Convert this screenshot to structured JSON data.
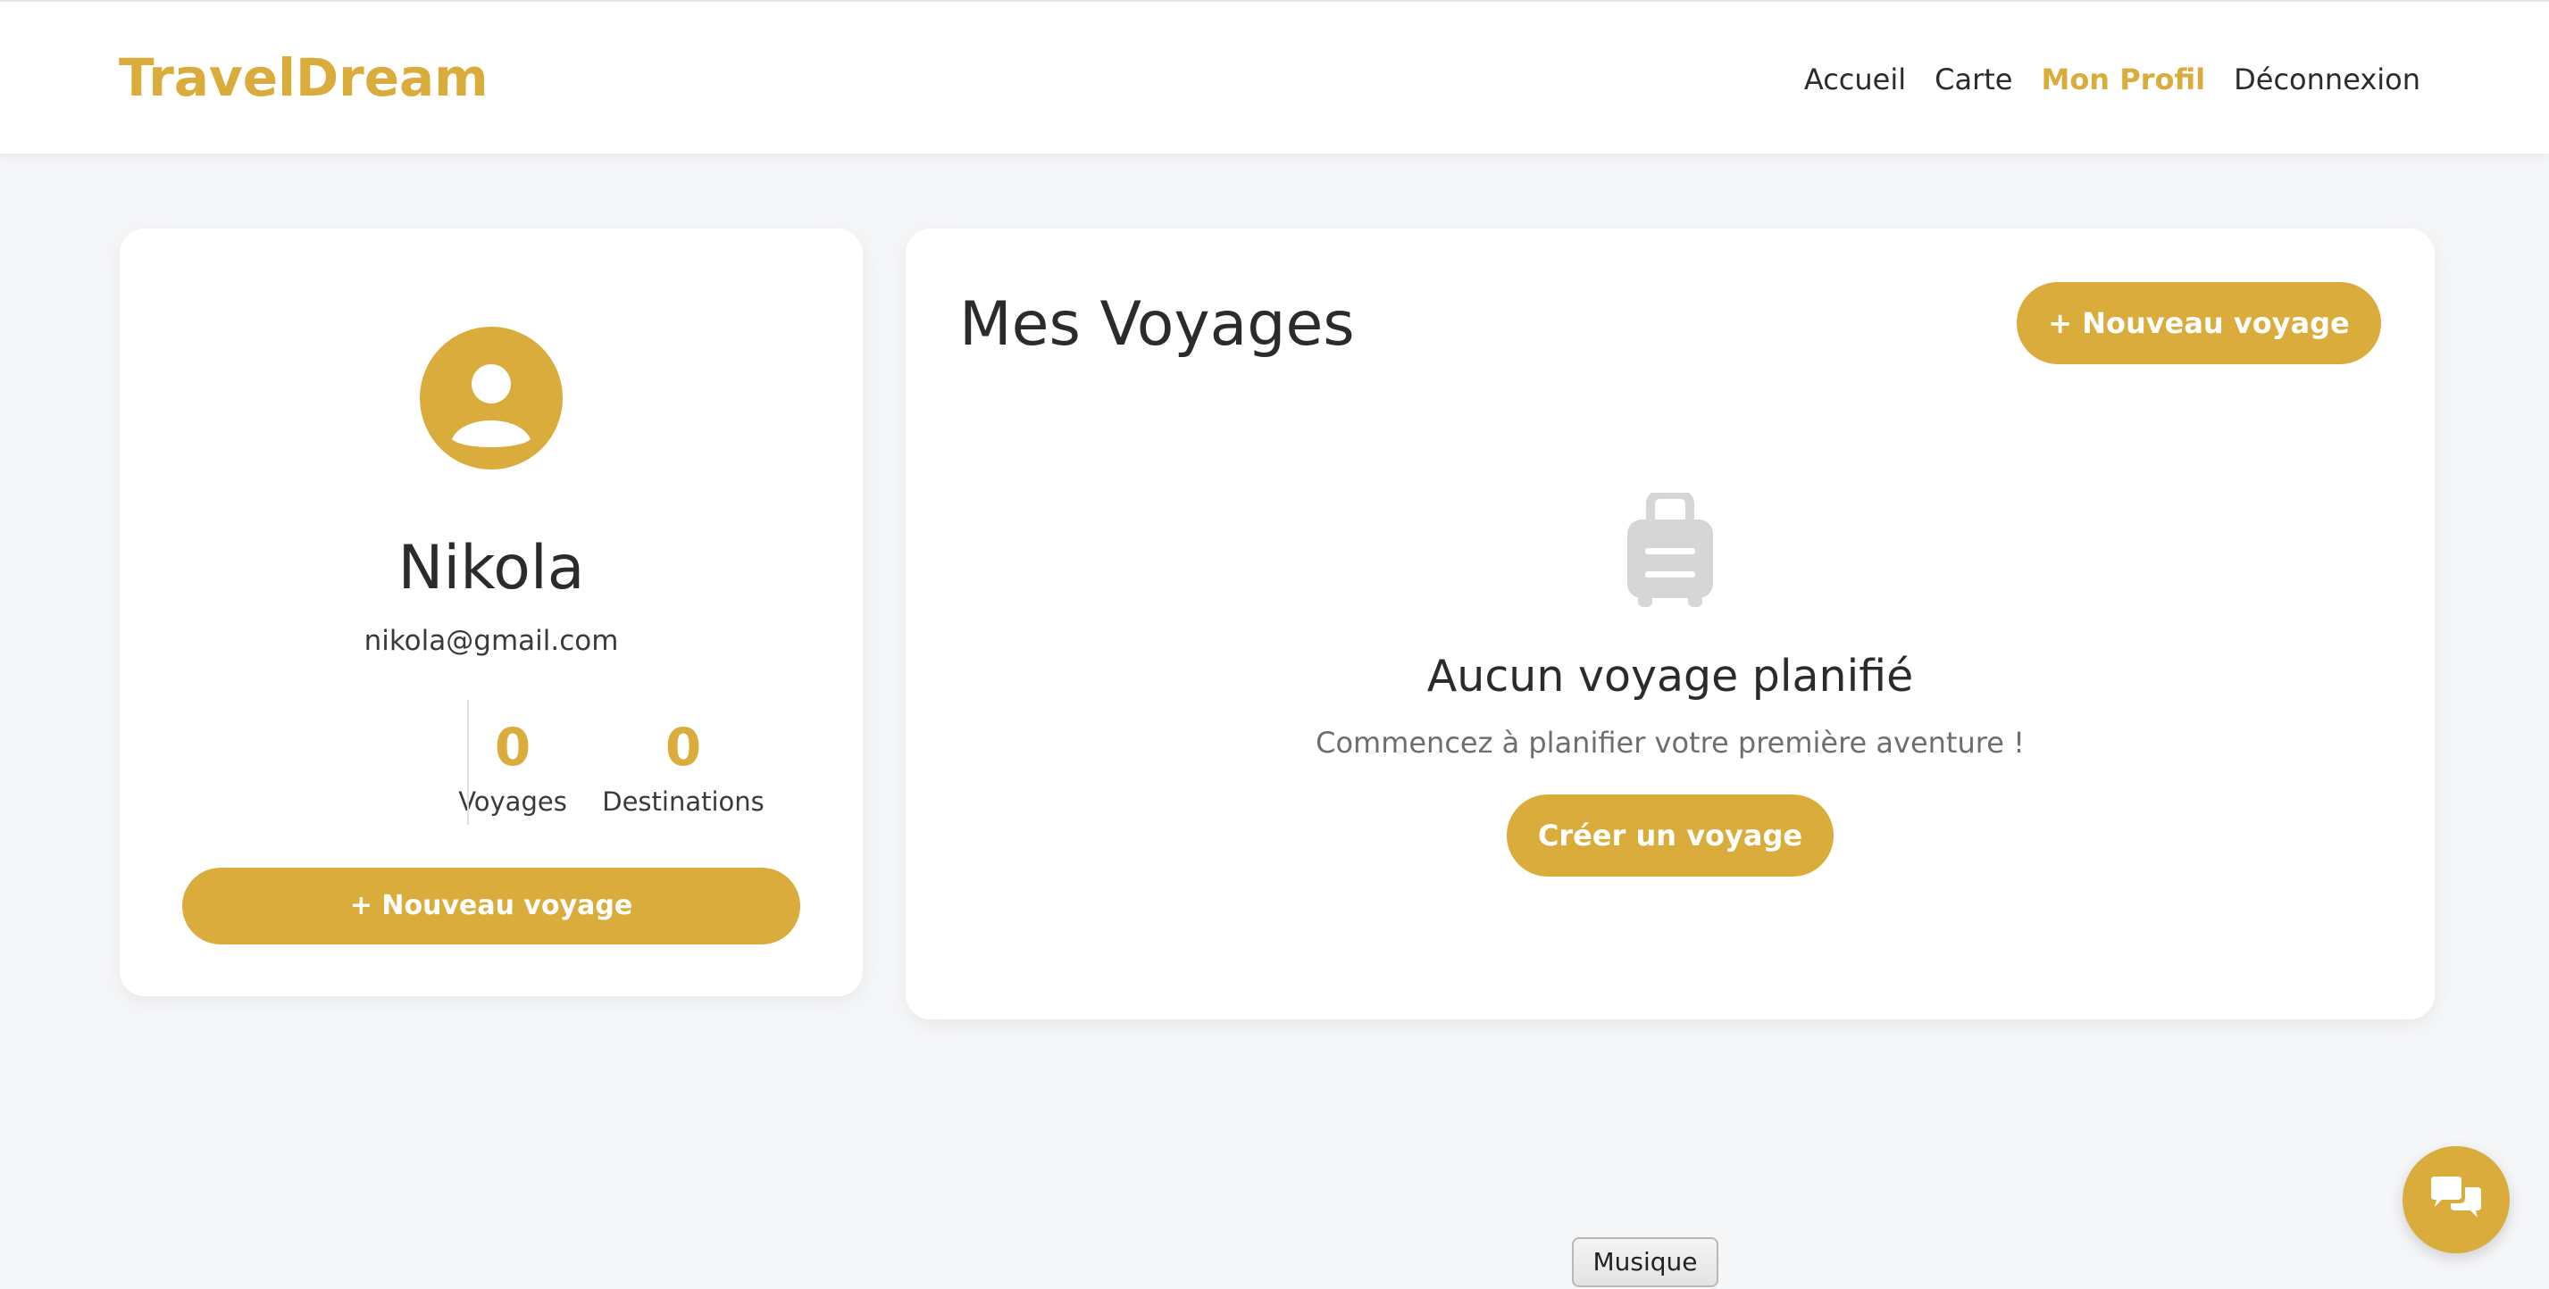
{
  "nav": {
    "brand": "TravelDream",
    "links": [
      "Accueil",
      "Carte",
      "Mon Profil",
      "Déconnexion"
    ],
    "active": "Mon Profil"
  },
  "profile": {
    "name": "Nikola",
    "email": "nikola@gmail.com",
    "stats": [
      {
        "value": "0",
        "label": "Voyages"
      },
      {
        "value": "0",
        "label": "Destinations"
      }
    ],
    "new_trip_label": "+ Nouveau voyage"
  },
  "trips": {
    "title": "Mes Voyages",
    "new_trip_label": "+ Nouveau voyage",
    "empty_title": "Aucun voyage planifié",
    "empty_subtitle": "Commencez à planifier votre première aventure !",
    "create_label": "Créer un voyage"
  },
  "music_button": "Musique",
  "icons": {
    "avatar": "user-circle-icon",
    "empty_state": "suitcase-icon",
    "chat": "chat-bubbles-icon"
  },
  "colors": {
    "accent": "#d9ac3b",
    "background": "#f5f6f8",
    "card": "#ffffff",
    "text": "#2b2b2b",
    "muted": "#6e6e6e",
    "suitcase": "#d6d6d6"
  }
}
